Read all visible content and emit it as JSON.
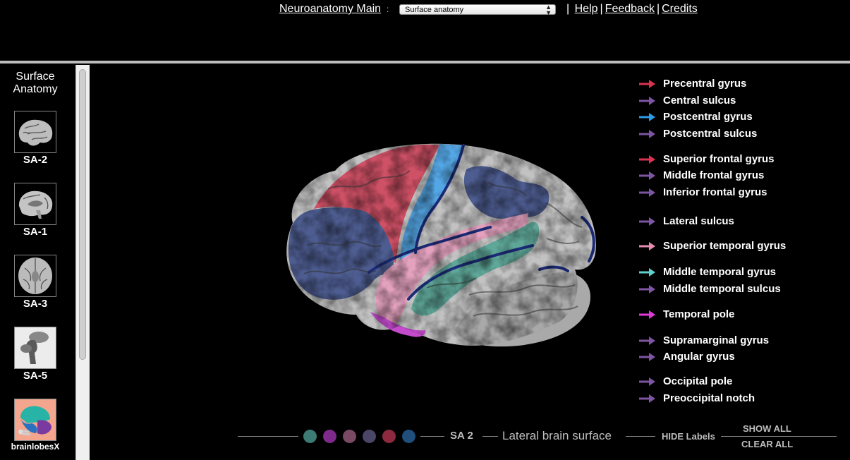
{
  "nav": {
    "main_link": "Neuroanatomy Main",
    "colon": ":",
    "select_value": "Surface anatomy",
    "sep": "|",
    "help": "Help",
    "feedback": "Feedback",
    "credits": "Credits"
  },
  "sidebar": {
    "title_line1": "Surface",
    "title_line2": "Anatomy",
    "items": [
      {
        "label": "SA-2",
        "icon": "brain-lateral-thumb"
      },
      {
        "label": "SA-1",
        "icon": "brain-medial-thumb"
      },
      {
        "label": "SA-3",
        "icon": "brain-inferior-thumb"
      },
      {
        "label": "SA-5",
        "icon": "brainstem-thumb"
      },
      {
        "label": "brainlobesX",
        "icon": "brain-lobes-thumb"
      }
    ]
  },
  "labels": [
    {
      "text": "Precentral gyrus",
      "color": "#d9334f"
    },
    {
      "text": "Central sulcus",
      "color": "#7e55a3"
    },
    {
      "text": "Postcentral gyrus",
      "color": "#2e9be8"
    },
    {
      "text": "Postcentral sulcus",
      "color": "#7e55a3"
    },
    {
      "text": "Superior frontal gyrus",
      "color": "#d9334f"
    },
    {
      "text": "Middle frontal gyrus",
      "color": "#7e55a3"
    },
    {
      "text": "Inferior frontal gyrus",
      "color": "#7e55a3"
    },
    {
      "text": "Lateral sulcus",
      "color": "#7e55a3"
    },
    {
      "text": "Superior temporal gyrus",
      "color": "#e98bb0"
    },
    {
      "text": "Middle temporal gyrus",
      "color": "#5fd0cd"
    },
    {
      "text": "Middle temporal sulcus",
      "color": "#7e55a3"
    },
    {
      "text": "Temporal pole",
      "color": "#e23ad8"
    },
    {
      "text": "Supramarginal gyrus",
      "color": "#7e55a3"
    },
    {
      "text": "Angular gyrus",
      "color": "#7e55a3"
    },
    {
      "text": "Occipital pole",
      "color": "#7e55a3"
    },
    {
      "text": "Preoccipital notch",
      "color": "#7e55a3"
    }
  ],
  "bottom": {
    "dots": [
      "#3e7a74",
      "#7e2a8a",
      "#7a4a62",
      "#4a4668",
      "#8e2a40",
      "#1f4f7a"
    ],
    "sa_code": "SA 2",
    "view_title": "Lateral brain surface",
    "hide_labels": "HIDE Labels",
    "show_all": "SHOW ALL",
    "clear_all": "CLEAR ALL"
  }
}
